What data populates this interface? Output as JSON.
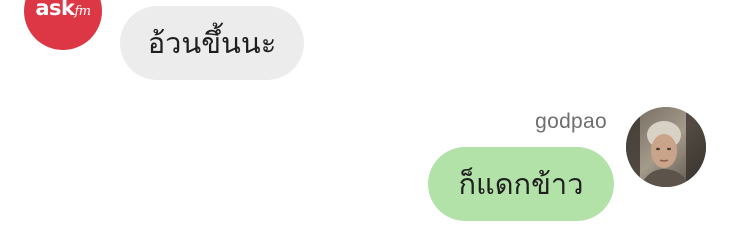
{
  "bot": {
    "logo_main": "ask",
    "logo_suffix": "fm",
    "message": "อ้วนขึ้นนะ"
  },
  "user": {
    "name": "godpao",
    "message": "ก็แดกข้าว",
    "avatar_icon": "user-photo"
  },
  "colors": {
    "brand_red": "#dd3645",
    "incoming_bubble": "#ececec",
    "outgoing_bubble": "#b3e2a8"
  }
}
